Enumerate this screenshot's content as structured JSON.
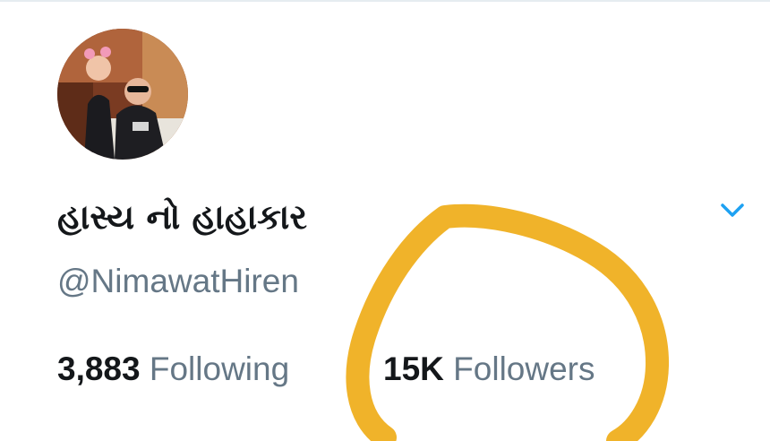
{
  "profile": {
    "display_name": "હાસ્ય નો હાહાકાર",
    "handle": "@NimawatHiren"
  },
  "stats": {
    "following": {
      "count": "3,883",
      "label": "Following"
    },
    "followers": {
      "count": "15K",
      "label": "Followers"
    }
  },
  "icons": {
    "menu": "chevron-down-icon"
  },
  "colors": {
    "accent": "#1da1f2",
    "annotation": "#f0b32a",
    "name_text": "#14171a",
    "secondary_text": "#657786"
  }
}
